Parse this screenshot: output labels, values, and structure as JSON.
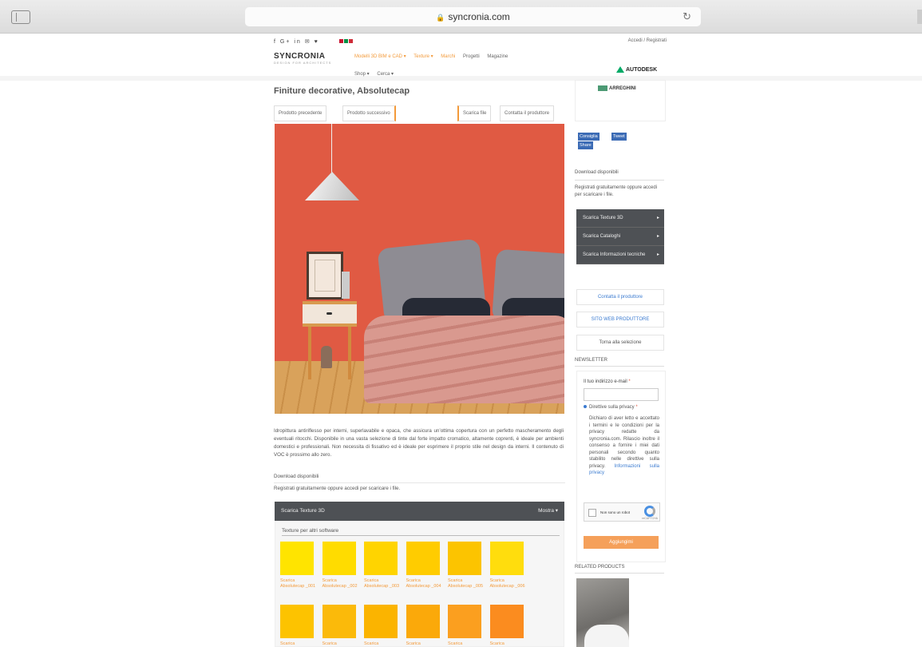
{
  "browser": {
    "url": "syncronia.com",
    "lock_icon": "lock-icon",
    "reload_icon": "reload-icon"
  },
  "header": {
    "social_icons": "f  G+ in ✉ ♥",
    "login": "Accedi / Registrati",
    "logo": "SYNCRONIA",
    "logo_sub": "DESIGN FOR ARCHITECTS",
    "nav": {
      "models": "Modelli 3D BIM e CAD ▾",
      "textures": "Texture ▾",
      "brands": "Marchi",
      "projects": "Progetti",
      "magazine": "Magazine",
      "shop": "Shop ▾",
      "search": "Cerca ▾"
    },
    "partner": "AUTODESK"
  },
  "main": {
    "title": "Finiture decorative, Absolutecap",
    "buttons": {
      "prev": "Prodotto precedente",
      "next": "Prodotto successivo",
      "download": "Scarica file",
      "contact": "Contatta il produttore"
    },
    "description": "Idropittura antiriflesso per interni, superlavabile e opaca, che assicura un’ottima copertura con un perfetto mascheramento degli eventuali ritocchi. Disponibile in una vasta selezione di tinte dal forte impatto cromatico, altamente coprenti, è ideale per ambienti domestici e professionali. Non necessita di fissativo ed è ideale per esprimere il proprio stile nel design da interni. Il contenuto di VOC è prossimo allo zero.",
    "downloads_heading": "Download disponibili",
    "downloads_note": "Registrati gratuitamente oppure accedi per scaricare i file.",
    "accordion": {
      "title": "Scarica Texture 3D",
      "show": "Mostra ▾"
    },
    "textures_heading": "Texture per altri software",
    "swatches_row1": [
      {
        "label": "Scarica Absolutecap _001",
        "color": "#ffe400"
      },
      {
        "label": "Scarica Absolutecap _002",
        "color": "#ffdc00"
      },
      {
        "label": "Scarica Absolutecap _003",
        "color": "#ffd400"
      },
      {
        "label": "Scarica Absolutecap _004",
        "color": "#ffcc00"
      },
      {
        "label": "Scarica Absolutecap _005",
        "color": "#fcc400"
      },
      {
        "label": "Scarica Absolutecap _006",
        "color": "#ffdd0d"
      }
    ],
    "swatches_row2": [
      {
        "label": "Scarica",
        "color": "#fdc300"
      },
      {
        "label": "Scarica",
        "color": "#fbba0a"
      },
      {
        "label": "Scarica",
        "color": "#fbb400"
      },
      {
        "label": "Scarica",
        "color": "#fba90a"
      },
      {
        "label": "Scarica",
        "color": "#fb9f1f"
      },
      {
        "label": "Scarica",
        "color": "#fb8c1f"
      }
    ]
  },
  "sidebar": {
    "brand": "ARREGHINI",
    "share": {
      "facebook": "Consiglia",
      "twitter": "Tweet",
      "linkedin": "Share"
    },
    "downloads_heading": "Download disponibili",
    "downloads_note": "Registrati gratuitamente oppure accedi per scaricare i file.",
    "menu": [
      {
        "label": "Scarica Texture 3D"
      },
      {
        "label": "Scarica Cataloghi"
      },
      {
        "label": "Scarica Informazioni tecniche"
      }
    ],
    "contact": "Contatta il produttore",
    "website": "SITO WEB PRODUTTORE",
    "back": "Torna alla selezione",
    "newsletter_heading": "NEWSLETTER",
    "email_label": "Il tuo indirizzo e-mail",
    "privacy_label": "Direttive sulla privacy",
    "privacy_text": "Dichiaro di aver letto e accettato i termini e le condizioni per la privacy redatte da syncronia.com. Rilascio inoltre il consenso a fornire i miei dati personali secondo quanto stabilito nelle direttive sulla privacy.",
    "privacy_link": "Informazioni sulla privacy",
    "captcha_label": "Non sono un robot",
    "captcha_brand": "reCAPTCHA",
    "subscribe": "Aggiungimi",
    "related_heading": "RELATED PRODUCTS"
  },
  "colors": {
    "accent": "#f39a3a",
    "dark": "#4e5155",
    "link": "#3b7bd0",
    "wall": "#e05a43"
  }
}
